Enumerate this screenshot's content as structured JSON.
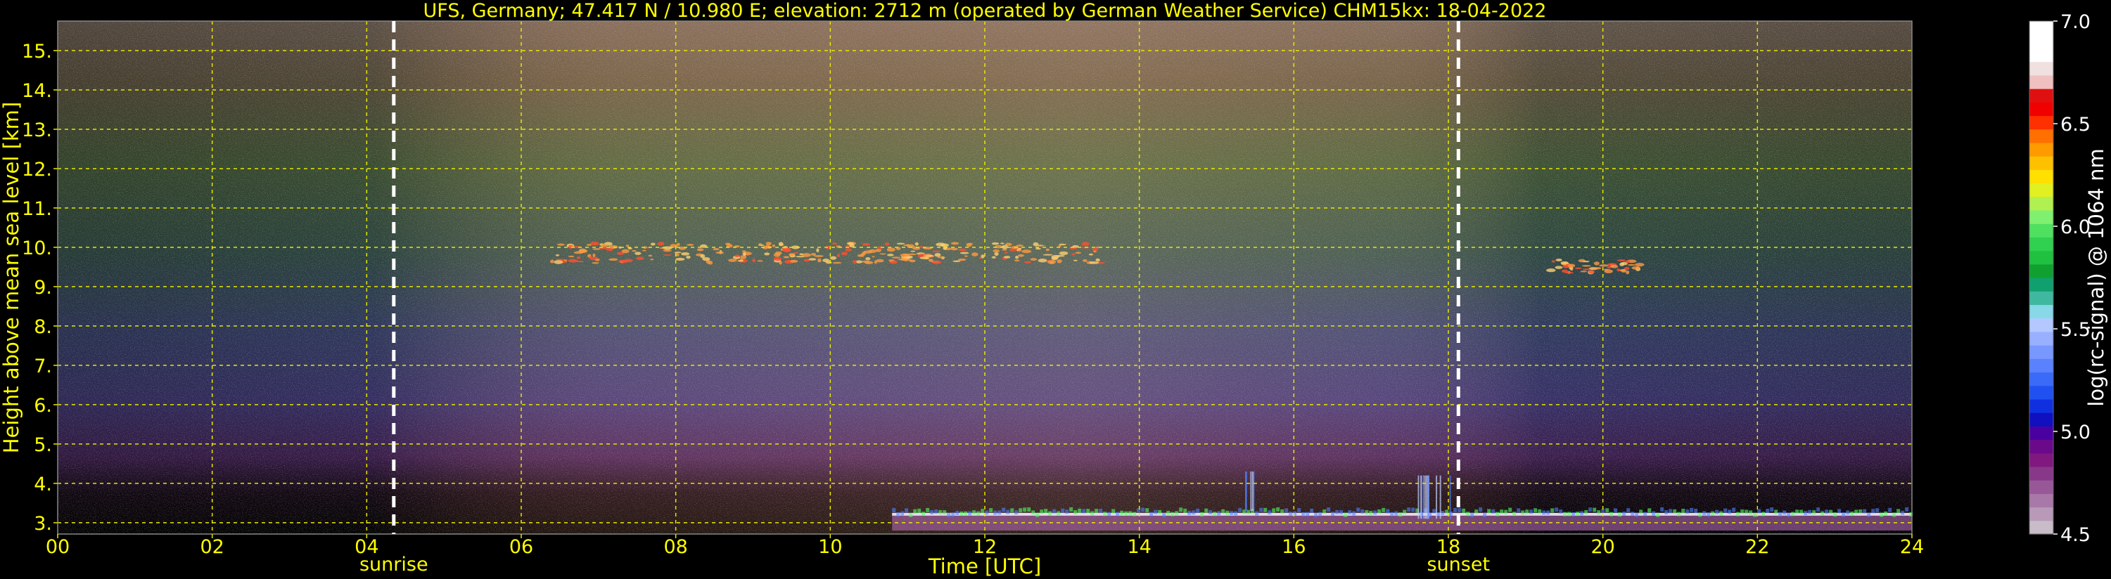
{
  "chart_data": {
    "type": "heatmap",
    "title": "UFS, Germany; 47.417 N / 10.980 E; elevation: 2712 m  (operated by German Weather Service)    CHM15kx: 18-04-2022",
    "xlabel": "Time [UTC]",
    "ylabel": "Height above mean sea level [km]",
    "xlim": [
      0,
      24
    ],
    "ylim": [
      2.712,
      15.75
    ],
    "x_ticks": [
      "00",
      "02",
      "04",
      "06",
      "08",
      "10",
      "12",
      "14",
      "16",
      "18",
      "20",
      "22",
      "24"
    ],
    "y_ticks": [
      "3.",
      "4.",
      "5.",
      "6.",
      "7.",
      "8.",
      "9.",
      "10.",
      "11.",
      "12.",
      "13.",
      "14.",
      "15."
    ],
    "grid": true,
    "annotations": [
      {
        "label": "sunrise",
        "x": 4.35
      },
      {
        "label": "sunset",
        "x": 18.13
      }
    ],
    "colorbar": {
      "label": "log(rc-signal) @ 1064 nm",
      "range": [
        4.5,
        7.0
      ],
      "ticks": [
        "4.5",
        "5.0",
        "5.5",
        "6.0",
        "6.5",
        "7.0"
      ]
    },
    "features": [
      {
        "kind": "cirrus",
        "x": [
          6.4,
          13.6
        ],
        "y": [
          9.4,
          10.4
        ]
      },
      {
        "kind": "cirrus",
        "x": [
          19.3,
          20.5
        ],
        "y": [
          9.2,
          9.9
        ]
      },
      {
        "kind": "boundary-layer",
        "x": [
          10.8,
          24.0
        ],
        "y": [
          2.8,
          3.25
        ]
      },
      {
        "kind": "precipitation-streaks",
        "x": [
          17.6,
          18.05
        ],
        "y": [
          3.1,
          4.2
        ]
      },
      {
        "kind": "precipitation-streaks",
        "x": [
          15.3,
          15.5
        ],
        "y": [
          3.3,
          4.3
        ]
      }
    ]
  },
  "colors": {
    "axis_text": "#ffff00",
    "grid": "#e8e800",
    "colorbar_text": "#ffffff",
    "background": "#000000"
  }
}
